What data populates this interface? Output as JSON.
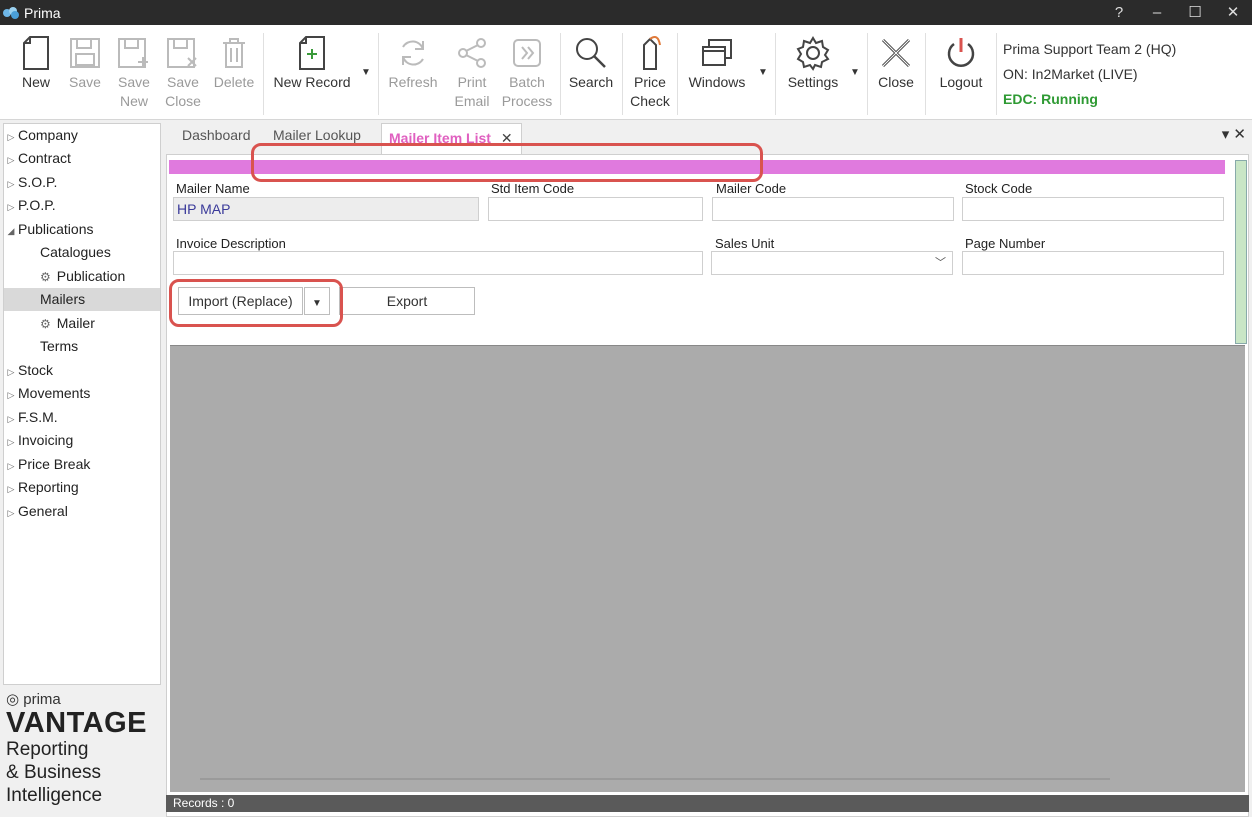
{
  "window": {
    "title": "Prima",
    "controls": [
      "?",
      "–",
      "☐",
      "✕"
    ]
  },
  "ribbon": {
    "new": "New",
    "save": "Save",
    "save_new_1": "Save",
    "save_new_2": "New",
    "save_close_1": "Save",
    "save_close_2": "Close",
    "delete": "Delete",
    "new_record": "New Record",
    "refresh": "Refresh",
    "print_email_1": "Print",
    "print_email_2": "Email",
    "batch_1": "Batch",
    "batch_2": "Process",
    "search": "Search",
    "price_1": "Price",
    "price_2": "Check",
    "windows": "Windows",
    "settings": "Settings",
    "close": "Close",
    "logout": "Logout"
  },
  "status": {
    "user": "Prima Support Team 2 (HQ)",
    "env": "ON: In2Market (LIVE)",
    "edc": "EDC: Running"
  },
  "sidebar": {
    "items": [
      "Company",
      "Contract",
      "S.O.P.",
      "P.O.P.",
      "Publications",
      "Catalogues",
      "Publication",
      "Mailers",
      "Mailer",
      "Terms",
      "Stock",
      "Movements",
      "F.S.M.",
      "Invoicing",
      "Price Break",
      "Reporting",
      "General"
    ]
  },
  "branding": {
    "prima": "prima",
    "vantage": "VANTAGE",
    "line1": "Reporting",
    "line2": "& Business",
    "line3": "Intelligence"
  },
  "tabs": {
    "dashboard": "Dashboard",
    "mailer_lookup": "Mailer Lookup",
    "mailer_item_list": "Mailer Item List",
    "close_x": "✕",
    "right": "▾ ✕"
  },
  "form": {
    "mailer_name_label": "Mailer Name",
    "mailer_name_value": "HP MAP",
    "std_item_code_label": "Std Item Code",
    "mailer_code_label": "Mailer Code",
    "stock_code_label": "Stock Code",
    "invoice_desc_label": "Invoice Description",
    "sales_unit_label": "Sales Unit",
    "page_number_label": "Page Number",
    "import_label": "Import (Replace)",
    "export_label": "Export"
  },
  "records": "Records : 0",
  "colors": {
    "accent_pink": "#e07ade",
    "edc_green": "#2e9a33",
    "highlight_red": "#d9534f"
  }
}
